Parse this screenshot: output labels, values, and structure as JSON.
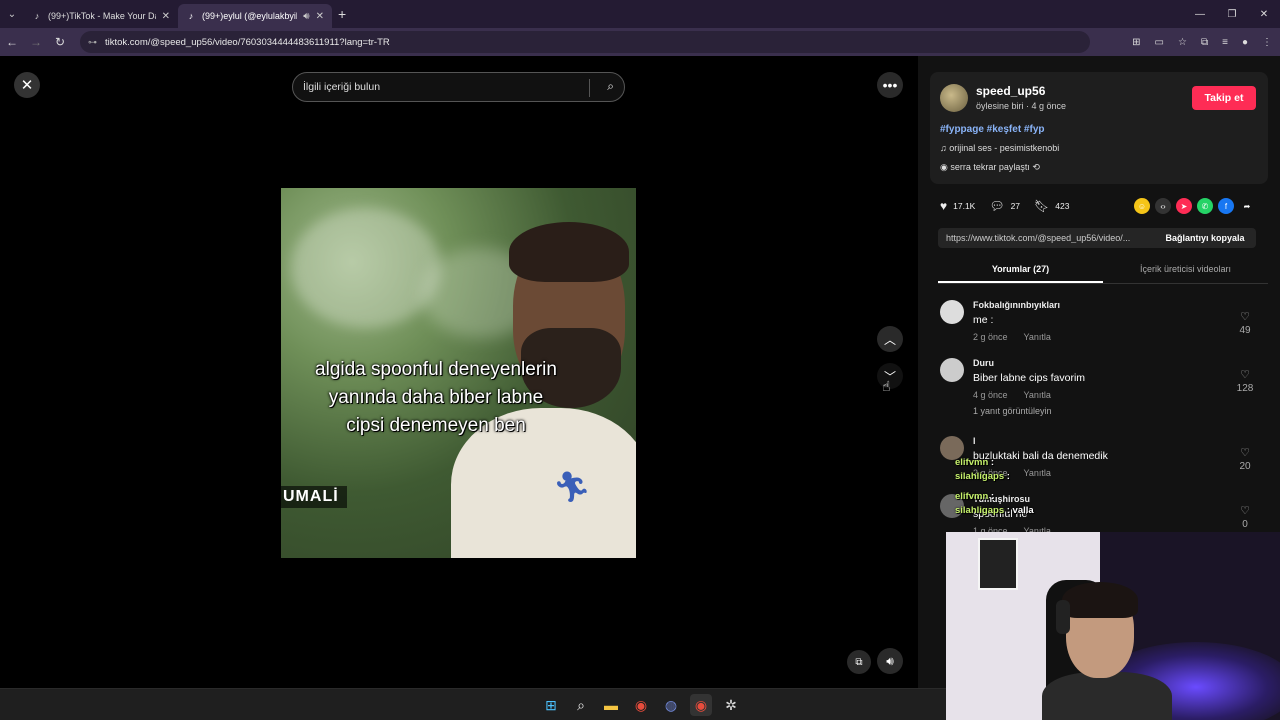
{
  "browser": {
    "tabs": [
      {
        "label": "(99+)TikTok - Make Your Day",
        "active": false
      },
      {
        "label": "(99+)eylul (@eylulakbyik) |",
        "active": true
      }
    ],
    "url_site": "⊶",
    "url": "tiktok.com/@speed_up56/video/7603034444483611911?lang=tr-TR"
  },
  "search": {
    "placeholder": "İlgili içeriği bulun"
  },
  "video": {
    "caption": "algida spoonful deneyenlerin\nyanında daha biber labne\ncipsi denemeyen ben",
    "name_tag": "UMALİ"
  },
  "author": {
    "username": "speed_up56",
    "subline": "öylesine biri · 4 g önce",
    "follow_label": "Takip et",
    "hashtags": "#fyppage #keşfet #fyp",
    "music": "orijinal ses - pesimistkenobi",
    "repost": "serra tekrar paylaştı"
  },
  "stats": {
    "likes": "17.1K",
    "comments": "27",
    "saves": "423"
  },
  "link": {
    "url": "https://www.tiktok.com/@speed_up56/video/...",
    "copy_label": "Bağlantıyı kopyala"
  },
  "panel_tabs": {
    "comments": "Yorumlar (27)",
    "creator": "İçerik üreticisi videoları"
  },
  "comments": [
    {
      "name": "Fokbalığınınbıyıkları",
      "text": "me :",
      "time": "2 g önce",
      "reply": "Yanıtla",
      "likes": "49",
      "replies": ""
    },
    {
      "name": "Duru",
      "text": "Biber labne cips favorim",
      "time": "4 g önce",
      "reply": "Yanıtla",
      "likes": "128",
      "replies": "1 yanıt görüntüleyin"
    },
    {
      "name": "l",
      "text": "buzluktaki bali da denemedik",
      "time": "2 g önce",
      "reply": "Yanıtla",
      "likes": "20",
      "replies": ""
    },
    {
      "name": "Yumuşhirosu",
      "text": "spoonful ne",
      "time": "1 g önce",
      "reply": "Yanıtla",
      "likes": "0",
      "replies": ""
    }
  ],
  "stream_chat": [
    {
      "user": "elifvmn",
      "msg": ":",
      "color": "#c5f06b"
    },
    {
      "user": "silahligaps",
      "msg": ":",
      "color": "#c5f06b"
    },
    {
      "user": "elifvmn",
      "msg": ":",
      "color": "#c5f06b"
    },
    {
      "user": "silahligaps",
      "msg": ": valla",
      "color": "#c5f06b"
    }
  ],
  "colors": {
    "accent": "#fe2c55",
    "link": "#8ab4f8"
  }
}
